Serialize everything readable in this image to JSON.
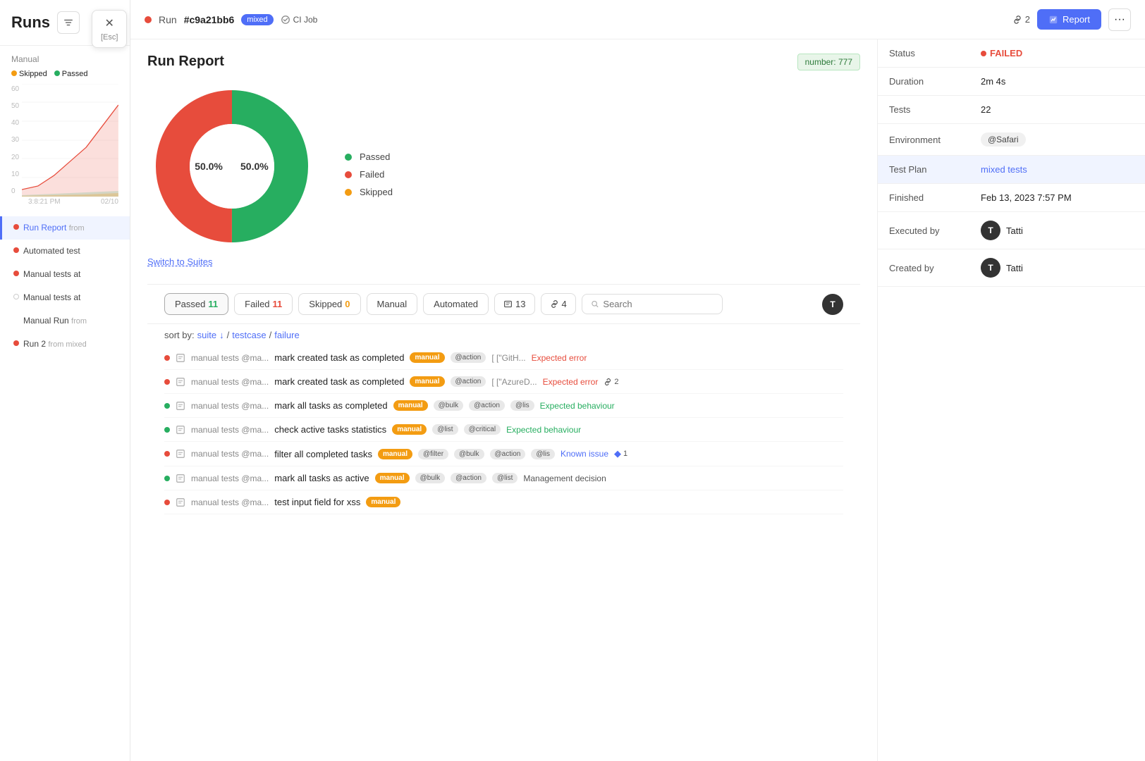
{
  "sidebar": {
    "title": "Runs",
    "legend": {
      "skipped": "Skipped",
      "passed": "Passed"
    },
    "y_axis": [
      "60",
      "50",
      "40",
      "30",
      "20",
      "10",
      "0"
    ],
    "x_labels": [
      "3:8:21 PM",
      "02/10"
    ],
    "items": [
      {
        "id": "run-report",
        "label": "Run Report",
        "sub": "from",
        "color": "#e74c3c",
        "active": true
      },
      {
        "id": "automated-test",
        "label": "Automated test",
        "sub": "",
        "color": "#e74c3c"
      },
      {
        "id": "manual-tests-at-1",
        "label": "Manual tests at",
        "sub": "",
        "color": "#e74c3c"
      },
      {
        "id": "manual-tests-at-2",
        "label": "Manual tests at",
        "sub": "",
        "color": "transparent"
      },
      {
        "id": "manual-run",
        "label": "Manual Run",
        "sub": "from",
        "color": "transparent"
      },
      {
        "id": "run-2",
        "label": "Run 2",
        "sub": "from mixed",
        "color": "#e74c3c"
      }
    ]
  },
  "topbar": {
    "run_id": "#c9a21bb6",
    "badge_mixed": "mixed",
    "ci_job": "CI Job",
    "link_count": "2",
    "report_btn": "Report",
    "more_btn": "..."
  },
  "report": {
    "title": "Run Report",
    "number_badge": "number: 777",
    "donut": {
      "passed_pct": "50.0%",
      "failed_pct": "50.0%",
      "legend": [
        {
          "color": "#27ae60",
          "label": "Passed"
        },
        {
          "color": "#e74c3c",
          "label": "Failed"
        },
        {
          "color": "#f39c12",
          "label": "Skipped"
        }
      ]
    },
    "switch_suites": "Switch to Suites",
    "info": {
      "status_label": "Status",
      "status_value": "FAILED",
      "duration_label": "Duration",
      "duration_value": "2m 4s",
      "tests_label": "Tests",
      "tests_value": "22",
      "environment_label": "Environment",
      "environment_value": "@Safari",
      "test_plan_label": "Test Plan",
      "test_plan_value": "mixed tests",
      "finished_label": "Finished",
      "finished_value": "Feb 13, 2023 7:57 PM",
      "executed_label": "Executed by",
      "executed_value": "Tatti",
      "created_label": "Created by",
      "created_value": "Tatti"
    }
  },
  "filters": {
    "passed": {
      "label": "Passed",
      "count": "11"
    },
    "failed": {
      "label": "Failed",
      "count": "11"
    },
    "skipped": {
      "label": "Skipped",
      "count": "0"
    },
    "manual": {
      "label": "Manual"
    },
    "automated": {
      "label": "Automated"
    },
    "issues": {
      "count": "13"
    },
    "links": {
      "count": "4"
    },
    "search_placeholder": "Search"
  },
  "sort": {
    "prefix": "sort by:",
    "suite": "suite",
    "testcase": "testcase",
    "failure": "failure"
  },
  "tests": [
    {
      "dot_color": "#e74c3c",
      "suite": "manual tests @ma...",
      "name": "mark created task as completed",
      "tag": "manual",
      "tags_gray": [
        "@action"
      ],
      "truncated": "[ [\"GitH...",
      "result": "Expected error",
      "result_type": "error",
      "link_count": ""
    },
    {
      "dot_color": "#e74c3c",
      "suite": "manual tests @ma...",
      "name": "mark created task as completed",
      "tag": "manual",
      "tags_gray": [
        "@action"
      ],
      "truncated": "[ [\"AzureD...",
      "result": "Expected error",
      "result_type": "error",
      "link_count": "2"
    },
    {
      "dot_color": "#27ae60",
      "suite": "manual tests @ma...",
      "name": "mark all tasks as completed",
      "tag": "manual",
      "tags_gray": [
        "@bulk",
        "@action",
        "@lis"
      ],
      "truncated": "",
      "result": "Expected behaviour",
      "result_type": "behaviour",
      "link_count": ""
    },
    {
      "dot_color": "#27ae60",
      "suite": "manual tests @ma...",
      "name": "check active tasks statistics",
      "tag": "manual",
      "tags_gray": [
        "@list",
        "@critical"
      ],
      "truncated": "",
      "result": "Expected behaviour",
      "result_type": "behaviour",
      "link_count": ""
    },
    {
      "dot_color": "#e74c3c",
      "suite": "manual tests @ma...",
      "name": "filter all completed tasks",
      "tag": "manual",
      "tags_gray": [
        "@filter",
        "@bulk",
        "@action",
        "@lis"
      ],
      "truncated": "",
      "result": "Known issue",
      "result_type": "known",
      "link_count": "1"
    },
    {
      "dot_color": "#27ae60",
      "suite": "manual tests @ma...",
      "name": "mark all tasks as active",
      "tag": "manual",
      "tags_gray": [
        "@bulk",
        "@action",
        "@list"
      ],
      "truncated": "",
      "result": "Management decision",
      "result_type": "management",
      "link_count": ""
    },
    {
      "dot_color": "#e74c3c",
      "suite": "manual tests @ma...",
      "name": "test input field for xss",
      "tag": "manual",
      "tags_gray": [],
      "truncated": "",
      "result": "",
      "result_type": "",
      "link_count": ""
    }
  ]
}
